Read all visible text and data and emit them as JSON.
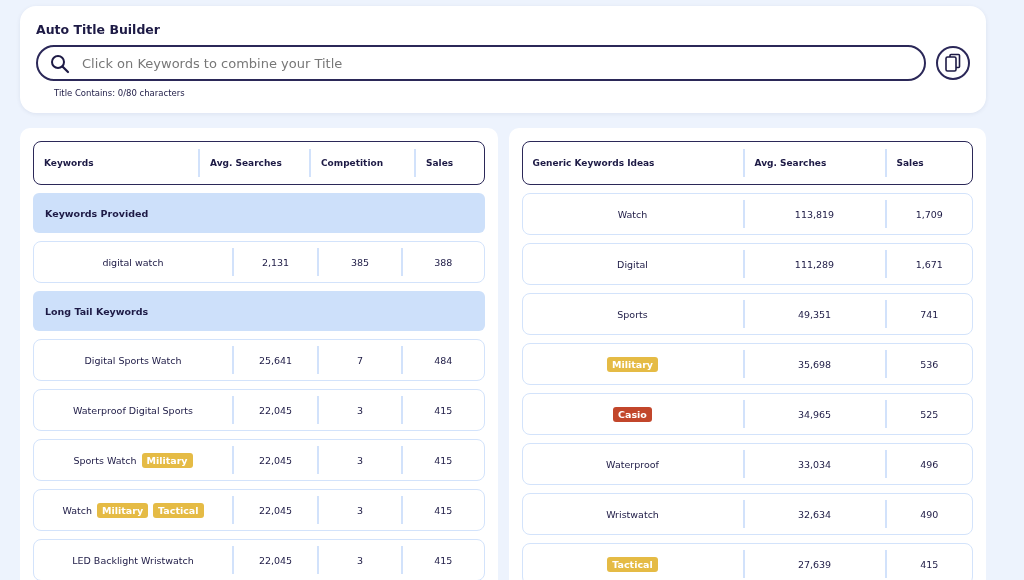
{
  "builder": {
    "title": "Auto Title Builder",
    "placeholder": "Click on Keywords to combine your Title",
    "counter": "Title Contains: 0/80 characters"
  },
  "keywords_table": {
    "columns": [
      "Keywords",
      "Avg. Searches",
      "Competition",
      "Sales"
    ],
    "sections": [
      {
        "title": "Keywords Provided",
        "rows": [
          {
            "keyword": [
              {
                "kind": "text",
                "text": "digital watch"
              }
            ],
            "avg_searches": "2,131",
            "competition": "385",
            "sales": "388"
          }
        ]
      },
      {
        "title": "Long Tail Keywords",
        "rows": [
          {
            "keyword": [
              {
                "kind": "text",
                "text": "Digital Sports Watch"
              }
            ],
            "avg_searches": "25,641",
            "competition": "7",
            "sales": "484"
          },
          {
            "keyword": [
              {
                "kind": "text",
                "text": "Waterproof Digital Sports"
              }
            ],
            "avg_searches": "22,045",
            "competition": "3",
            "sales": "415"
          },
          {
            "keyword": [
              {
                "kind": "text",
                "text": "Sports Watch"
              },
              {
                "kind": "tag",
                "text": "Military",
                "color": "#e5bb45"
              }
            ],
            "avg_searches": "22,045",
            "competition": "3",
            "sales": "415"
          },
          {
            "keyword": [
              {
                "kind": "text",
                "text": "Watch"
              },
              {
                "kind": "tag",
                "text": "Military",
                "color": "#e5bb45"
              },
              {
                "kind": "tag",
                "text": "Tactical",
                "color": "#e5bb45"
              }
            ],
            "avg_searches": "22,045",
            "competition": "3",
            "sales": "415"
          },
          {
            "keyword": [
              {
                "kind": "text",
                "text": "LED Backlight Wristwatch"
              }
            ],
            "avg_searches": "22,045",
            "competition": "3",
            "sales": "415"
          }
        ]
      }
    ]
  },
  "generic_table": {
    "columns": [
      "Generic Keywords Ideas",
      "Avg. Searches",
      "Sales"
    ],
    "rows": [
      {
        "keyword": [
          {
            "kind": "text",
            "text": "Watch"
          }
        ],
        "avg_searches": "113,819",
        "sales": "1,709"
      },
      {
        "keyword": [
          {
            "kind": "text",
            "text": "Digital"
          }
        ],
        "avg_searches": "111,289",
        "sales": "1,671"
      },
      {
        "keyword": [
          {
            "kind": "text",
            "text": "Sports"
          }
        ],
        "avg_searches": "49,351",
        "sales": "741"
      },
      {
        "keyword": [
          {
            "kind": "tag",
            "text": "Military",
            "color": "#e5bb45"
          }
        ],
        "avg_searches": "35,698",
        "sales": "536"
      },
      {
        "keyword": [
          {
            "kind": "tag",
            "text": "Casio",
            "color": "#c2462b"
          }
        ],
        "avg_searches": "34,965",
        "sales": "525"
      },
      {
        "keyword": [
          {
            "kind": "text",
            "text": "Waterproof"
          }
        ],
        "avg_searches": "33,034",
        "sales": "496"
      },
      {
        "keyword": [
          {
            "kind": "text",
            "text": "Wristwatch"
          }
        ],
        "avg_searches": "32,634",
        "sales": "490"
      },
      {
        "keyword": [
          {
            "kind": "tag",
            "text": "Tactical",
            "color": "#e5bb45"
          }
        ],
        "avg_searches": "27,639",
        "sales": "415"
      }
    ]
  }
}
